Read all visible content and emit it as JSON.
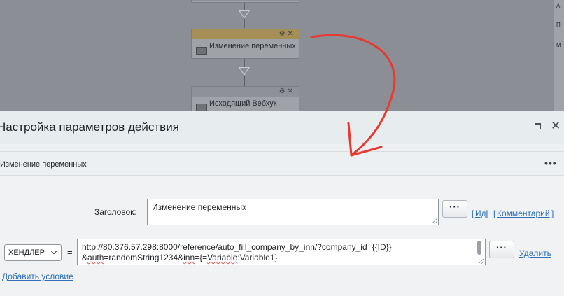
{
  "canvas": {
    "blocks": [
      {
        "label": "",
        "header_style": "gray"
      },
      {
        "label": "Изменение переменных",
        "header_style": "active"
      },
      {
        "label": "Исходящий Вебхук",
        "header_style": "gray"
      }
    ],
    "block_icons": "⚙✕",
    "right_panel_labels": [
      "А",
      "П",
      "М"
    ]
  },
  "dialog": {
    "title": "Настройка параметров действия",
    "maximize_icon": "maximize-icon",
    "close_symbol": "✕",
    "section_title": "Изменение переменных",
    "more_symbol": "•••",
    "title_label": "Заголовок:",
    "title_value": "Изменение переменных",
    "dots_label": "···",
    "link_id": "Ид",
    "link_comment": "Комментарий",
    "bracket_open": "[",
    "bracket_close": "]",
    "handler_select_value": "ХЕНДЛЕР",
    "equals": "=",
    "url_line1": "http://80.376.57.298:8000/reference/auto_fill_company_by_inn/?company_id={{ID}}",
    "url_line2_pre": "&",
    "url_line2_auth": "auth",
    "url_line2_mid": "=randomString1234&",
    "url_line2_inn": "inn",
    "url_line2_post": "={=",
    "url_line2_var": "Variable",
    "url_line2_end": ":Variable1}",
    "delete_link": "Удалить",
    "add_condition_link": "Добавить условие"
  },
  "annotation": {
    "color": "#e8392f"
  }
}
